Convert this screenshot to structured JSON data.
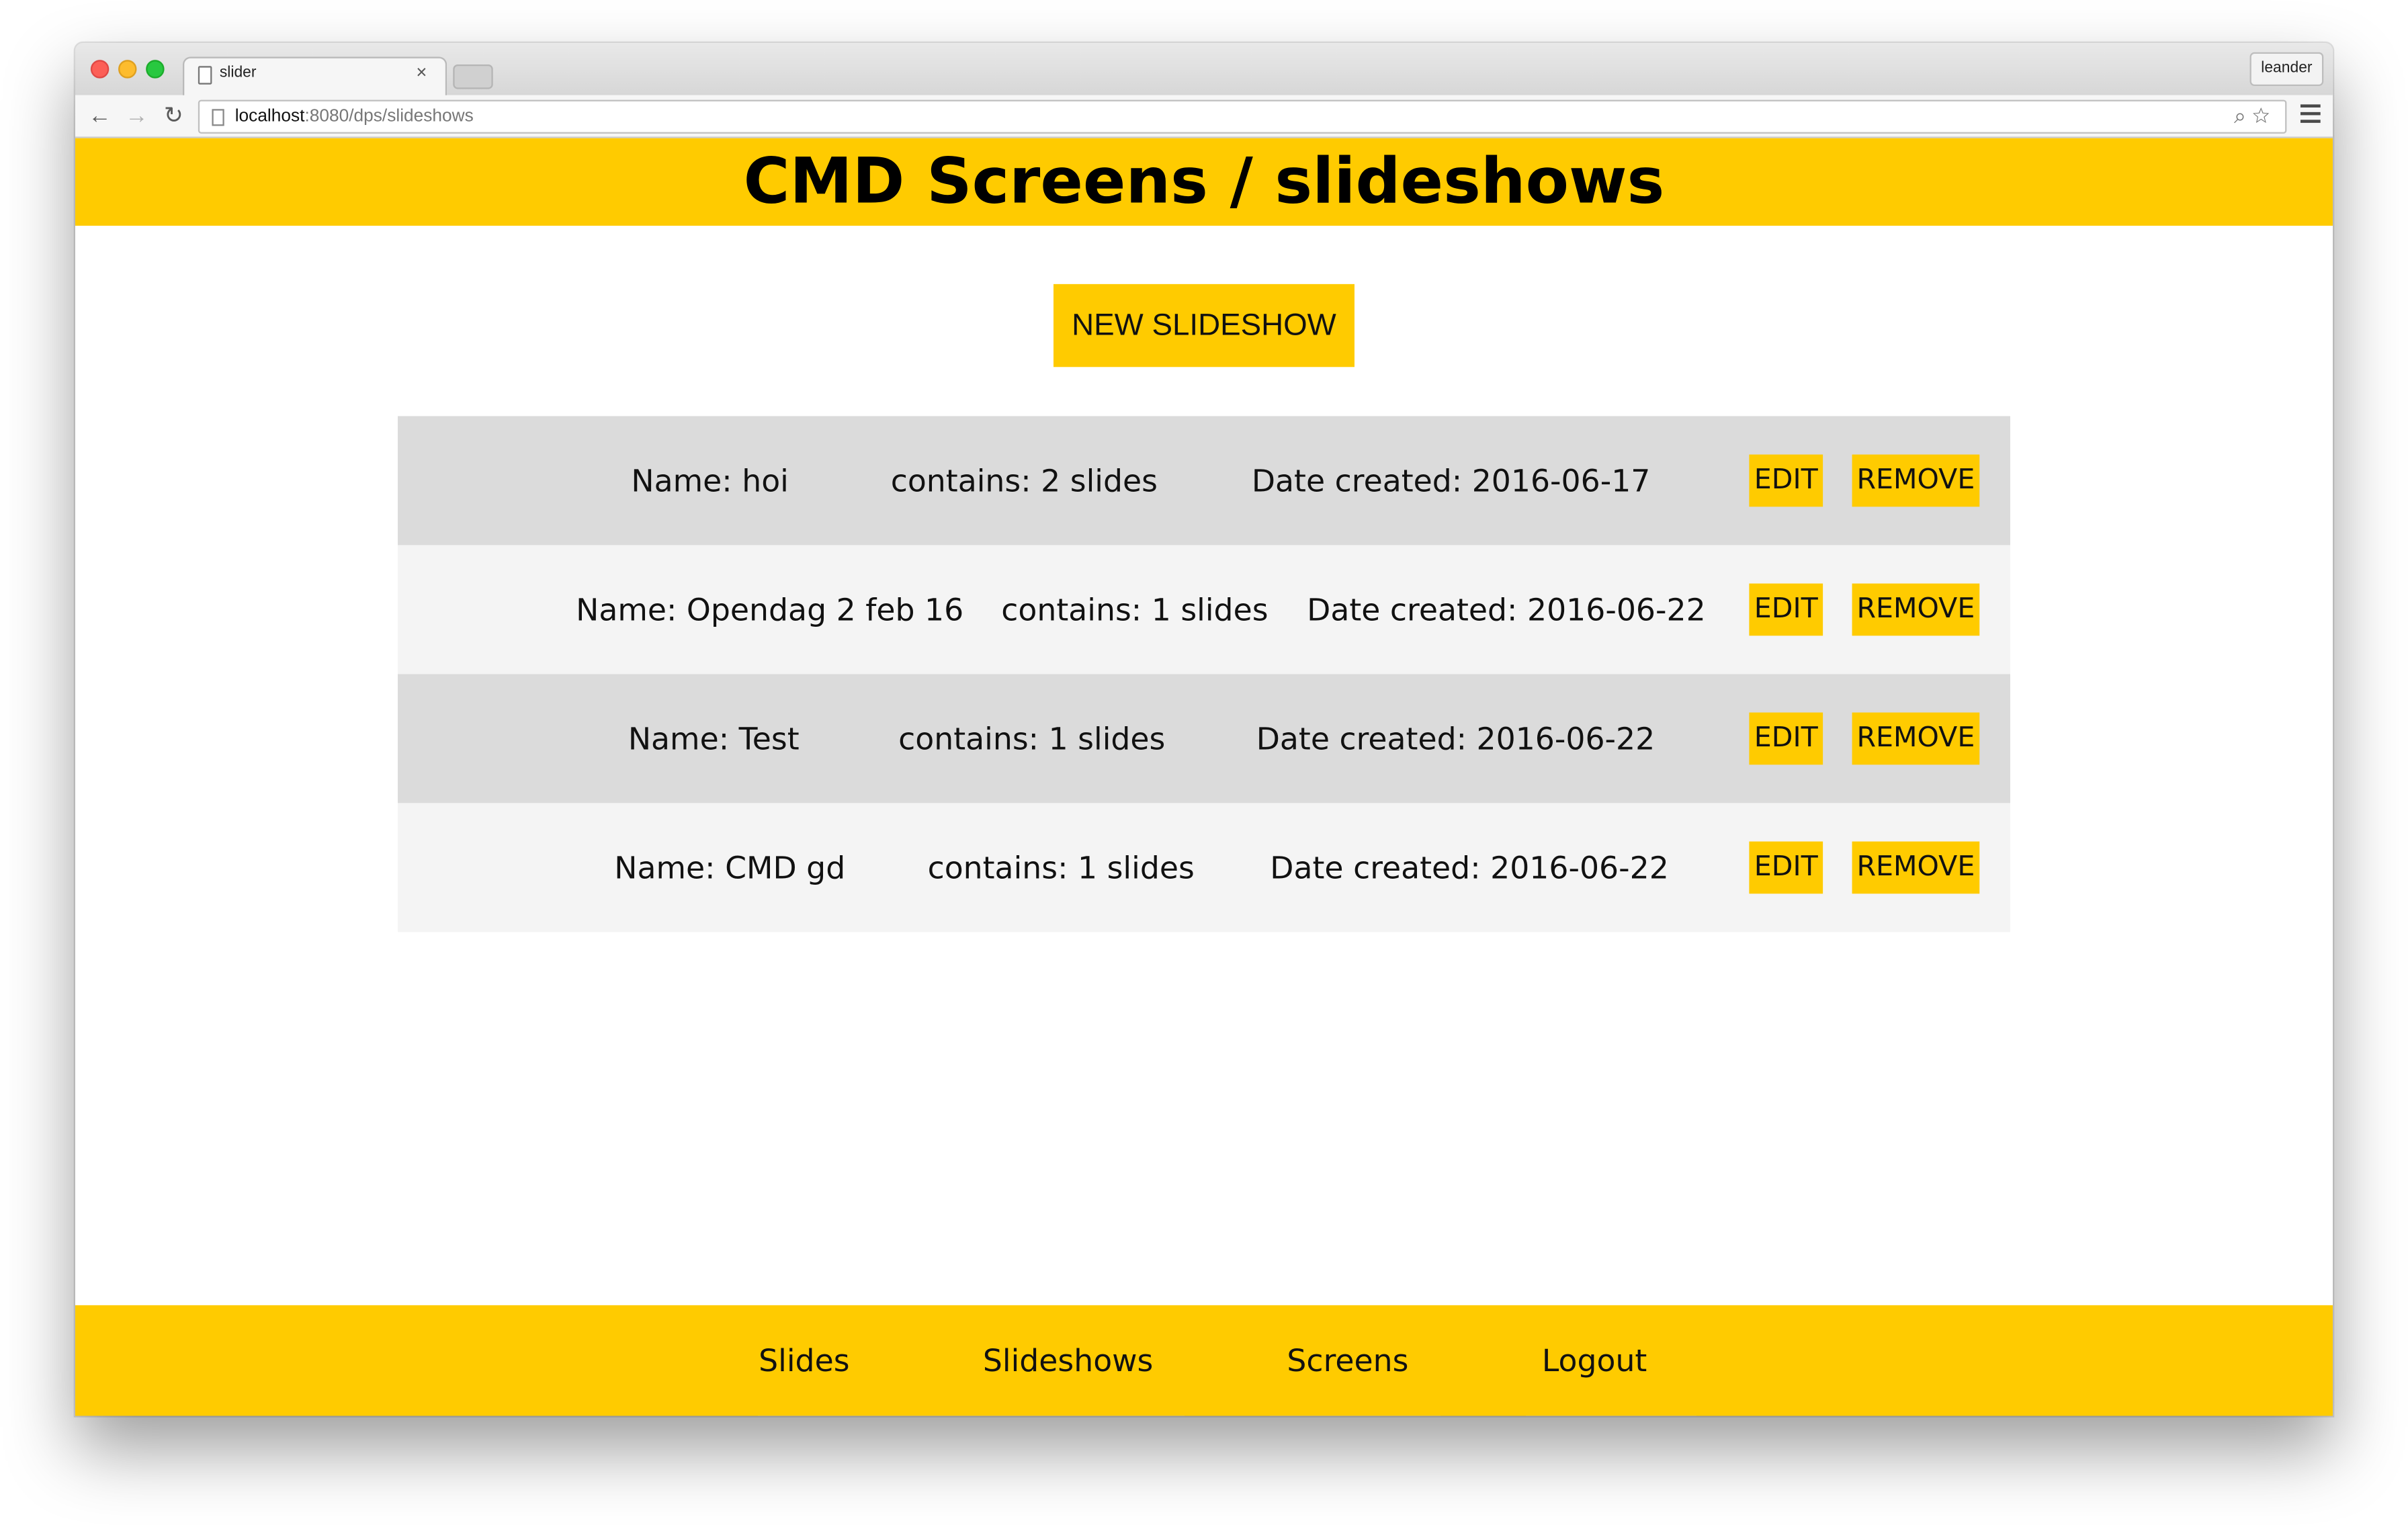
{
  "browser": {
    "tab_title": "slider",
    "tab_close": "×",
    "profile_name": "leander",
    "url_host": "localhost",
    "url_path": ":8080/dps/slideshows",
    "back_glyph": "←",
    "forward_glyph": "→",
    "reload_glyph": "↻",
    "icons": [
      "zoom-icon",
      "star-icon",
      "menu-icon"
    ]
  },
  "header": {
    "title": "CMD Screens / slideshows"
  },
  "actions": {
    "new_label": "NEW SLIDESHOW"
  },
  "slideshows": [
    {
      "name": "Name: hoi",
      "contains": "contains: 2 slides",
      "date": "Date created: 2016-06-17"
    },
    {
      "name": "Name: Opendag 2 feb 16",
      "contains": "contains: 1 slides",
      "date": "Date created: 2016-06-22"
    },
    {
      "name": "Name: Test",
      "contains": "contains: 1 slides",
      "date": "Date created: 2016-06-22"
    },
    {
      "name": "Name: CMD gd",
      "contains": "contains: 1 slides",
      "date": "Date created: 2016-06-22"
    }
  ],
  "row_buttons": {
    "edit": "EDIT",
    "remove": "REMOVE"
  },
  "footer": {
    "links": [
      "Slides",
      "Slideshows",
      "Screens",
      "Logout"
    ]
  },
  "colors": {
    "accent": "#ffcb00",
    "row_odd": "#dbdbdb",
    "row_even": "#f4f4f4"
  }
}
